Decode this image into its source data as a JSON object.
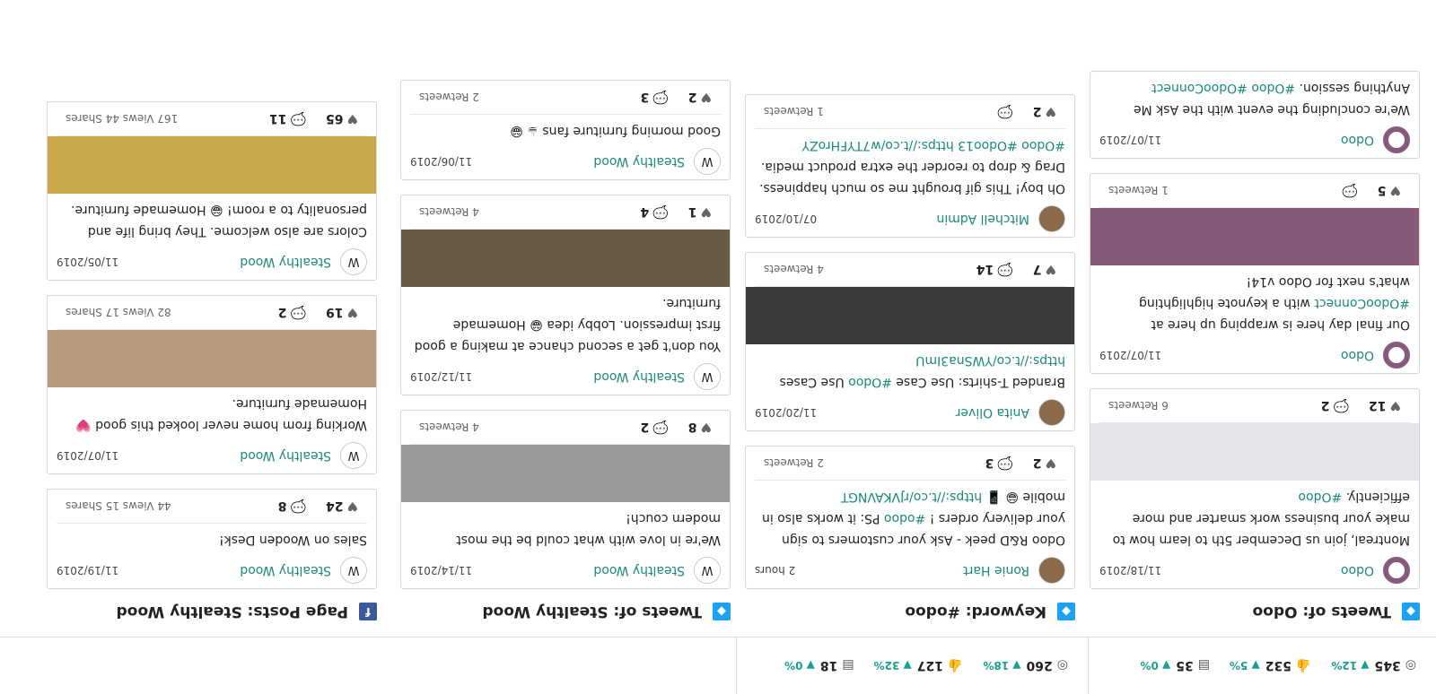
{
  "stats": {
    "fb": [
      {
        "icon": "target-icon",
        "value": "345",
        "trend": "12%"
      },
      {
        "icon": "thumb-icon",
        "value": "532",
        "trend": "5%"
      },
      {
        "icon": "post-icon",
        "value": "35",
        "trend": "0%"
      }
    ],
    "tw": [
      {
        "icon": "target-icon",
        "value": "260",
        "trend": "18%"
      },
      {
        "icon": "thumb-icon",
        "value": "127",
        "trend": "32%"
      },
      {
        "icon": "post-icon",
        "value": "18",
        "trend": "0%"
      }
    ]
  },
  "columns": [
    {
      "title": "Page Posts: Stealthy Wood",
      "badge": "f",
      "badge_color": "#3b5998",
      "posts": [
        {
          "author": "Stealthy Wood",
          "date": "11/19/2019",
          "text": "Sales on Wooden Desk!",
          "likes": "24",
          "comments": "8",
          "shares": "15 Shares",
          "views": "44 Views",
          "media": ""
        },
        {
          "author": "Stealthy Wood",
          "date": "11/07/2019",
          "text": "Working from home never looked this good 💗 Homemade furniture.",
          "likes": "19",
          "comments": "2",
          "shares": "17 Shares",
          "views": "82 Views",
          "media": "#b79a7c"
        },
        {
          "author": "Stealthy Wood",
          "date": "11/05/2019",
          "text": "Colors are also welcome. They bring life and personality to a room! 😁 Homemade furniture.",
          "likes": "65",
          "comments": "11",
          "shares": "44 Shares",
          "views": "167 Views",
          "media": "#c9a94a"
        }
      ]
    },
    {
      "title": "Tweets of: Stealthy Wood",
      "badge": "◆",
      "badge_color": "#1da1f2",
      "posts": [
        {
          "author": "Stealthy Wood",
          "date": "11/14/2019",
          "text": "We're in love with what could be the most modern couch!",
          "likes": "8",
          "comments": "2",
          "shares": "4 Retweets",
          "media": "#9a9a9a"
        },
        {
          "author": "Stealthy Wood",
          "date": "11/12/2019",
          "text": "You don't get a second chance at making a good first impression. Lobby idea 😁 Homemade furniture.",
          "likes": "1",
          "comments": "4",
          "shares": "4 Retweets",
          "media": "#6a5a48"
        },
        {
          "author": "Stealthy Wood",
          "date": "11/06/2019",
          "text": "Good morning furniture fans ☕ 😁",
          "likes": "2",
          "comments": "3",
          "shares": "2 Retweets",
          "media": ""
        }
      ]
    },
    {
      "title": "Keyword: #odoo",
      "badge": "◆",
      "badge_color": "#1da1f2",
      "posts": [
        {
          "author": "Ronie Hart",
          "date": "2 hours",
          "text": "Odoo R&D peek - Ask your customers to sign your delivery orders ! #odoo PS: it works also in mobile 😁 📱 https://t.co/rJVKAVNGT",
          "likes": "2",
          "comments": "3",
          "shares": "2 Retweets",
          "media": ""
        },
        {
          "author": "Anita Oliver",
          "date": "11/20/2019",
          "text": "Branded T-shirts: Use Case #Odoo Use Cases https://t.co/YWSna3ImU",
          "likes": "7",
          "comments": "14",
          "shares": "4 Retweets",
          "media": "#3a3a3a"
        },
        {
          "author": "Mitchell Admin",
          "date": "07/10/2019",
          "text": "Oh boy! This gif brought me so much happiness. Drag & drop to reorder the extra product media. #Odoo #Odoo13 https://t.co/w7TYFHroZY",
          "likes": "2",
          "comments": "",
          "shares": "1 Retweets",
          "media": ""
        }
      ]
    },
    {
      "title": "Tweets of: Odoo",
      "badge": "◆",
      "badge_color": "#1da1f2",
      "posts": [
        {
          "author": "Odoo",
          "date": "11/18/2019",
          "text": "Montreal, join us December 5th to learn how to make your business work smarter and more efficiently. #Odoo",
          "likes": "12",
          "comments": "2",
          "shares": "6 Retweets",
          "media": "#e4e6ea"
        },
        {
          "author": "Odoo",
          "date": "11/07/2019",
          "text": "Our final day here is wrapping up here at #OdooConnect with a keynote highlighting what's next for Odoo v14!",
          "likes": "5",
          "comments": "",
          "shares": "1 Retweets",
          "media": "#875a7b"
        },
        {
          "author": "Odoo",
          "date": "11/07/2019",
          "text": "We're concluding the event with the Ask Me Anything session. #Odoo #OdooConnect",
          "likes": "",
          "comments": "",
          "shares": "",
          "media": ""
        }
      ]
    }
  ]
}
